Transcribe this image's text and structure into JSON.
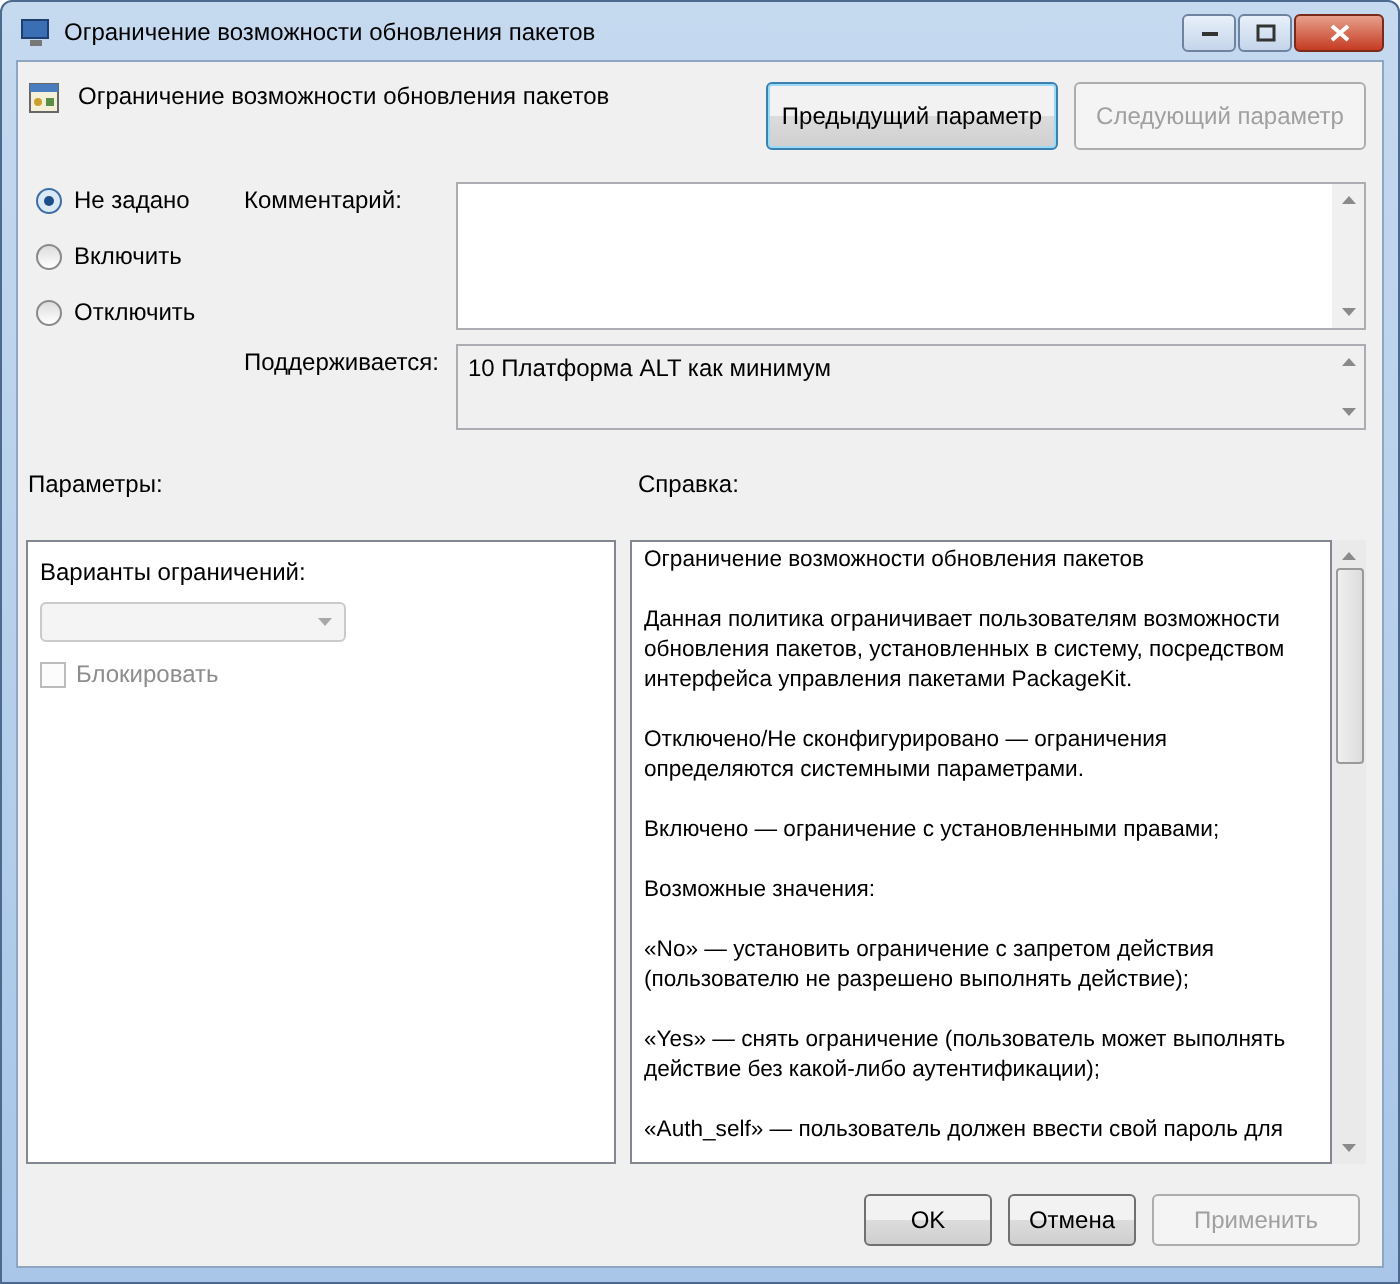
{
  "window": {
    "title": "Ограничение возможности обновления пакетов"
  },
  "policy": {
    "title": "Ограничение возможности обновления пакетов"
  },
  "nav_buttons": [
    {
      "label": "Предыдущий параметр",
      "disabled": false,
      "focused": true
    },
    {
      "label": "Следующий параметр",
      "disabled": true,
      "focused": false
    }
  ],
  "states": [
    {
      "label": "Не задано",
      "selected": true
    },
    {
      "label": "Включить",
      "selected": false
    },
    {
      "label": "Отключить",
      "selected": false
    }
  ],
  "comment": {
    "label": "Комментарий:"
  },
  "supported": {
    "label": "Поддерживается:",
    "value": "10 Платформа ALT как минимум"
  },
  "options_label": "Параметры:",
  "help_label": "Справка:",
  "options": {
    "label": "Варианты ограничений:",
    "dropdown": {
      "disabled": true
    },
    "checkbox": {
      "label": "Блокировать",
      "checked": false,
      "disabled": true
    }
  },
  "help": [
    "Ограничение возможности обновления пакетов",
    "Данная политика ограничивает пользователям возможности обновления пакетов, установленных в систему, посредством интерфейса управления пакетами PackageKit.",
    "Отключено/Не сконфигурировано — ограничения определяются системными параметрами.",
    "Включено — ограничение с установленными правами;",
    "Возможные значения:",
    "«No» — установить ограничение с запретом действия (пользователю не разрешено выполнять действие);",
    "«Yes» — снять ограничение (пользователь может выполнять действие без какой-либо аутентификации);",
    "«Auth_self» — пользователь должен ввести свой пароль для"
  ],
  "buttons": [
    {
      "label": "OK",
      "disabled": false
    },
    {
      "label": "Отмена",
      "disabled": false
    },
    {
      "label": "Применить",
      "disabled": true
    }
  ]
}
